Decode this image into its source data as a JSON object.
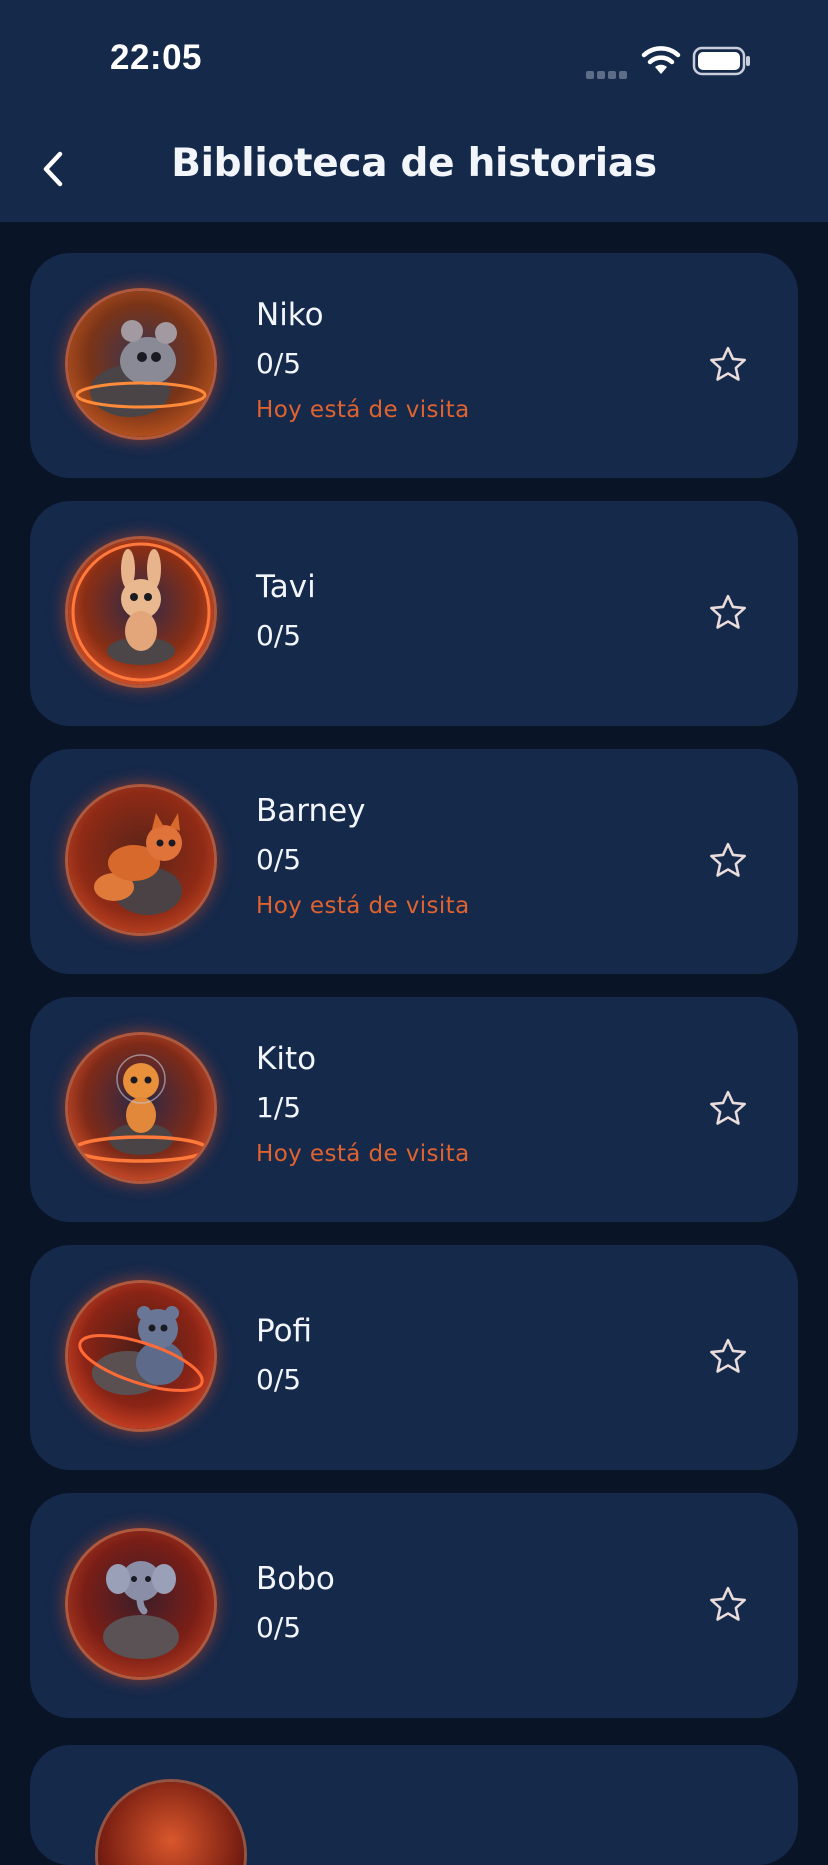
{
  "status_bar": {
    "time": "22:05"
  },
  "header": {
    "title": "Biblioteca de historias"
  },
  "stories": [
    {
      "name": "Niko",
      "progress": "0/5",
      "visit": "Hoy está de visita",
      "animal": "mouse",
      "favorite": false
    },
    {
      "name": "Tavi",
      "progress": "0/5",
      "visit": "",
      "animal": "bunny",
      "favorite": false
    },
    {
      "name": "Barney",
      "progress": "0/5",
      "visit": "Hoy está de visita",
      "animal": "fox",
      "favorite": false
    },
    {
      "name": "Kito",
      "progress": "1/5",
      "visit": "Hoy está de visita",
      "animal": "tiger",
      "favorite": false
    },
    {
      "name": "Pofi",
      "progress": "0/5",
      "visit": "",
      "animal": "bear",
      "favorite": false
    },
    {
      "name": "Bobo",
      "progress": "0/5",
      "visit": "",
      "animal": "elephant",
      "favorite": false
    }
  ],
  "colors": {
    "header_bg": "#15294b",
    "page_bg": "#0a1427",
    "card_bg": "#15294b",
    "accent": "#e0622f"
  }
}
